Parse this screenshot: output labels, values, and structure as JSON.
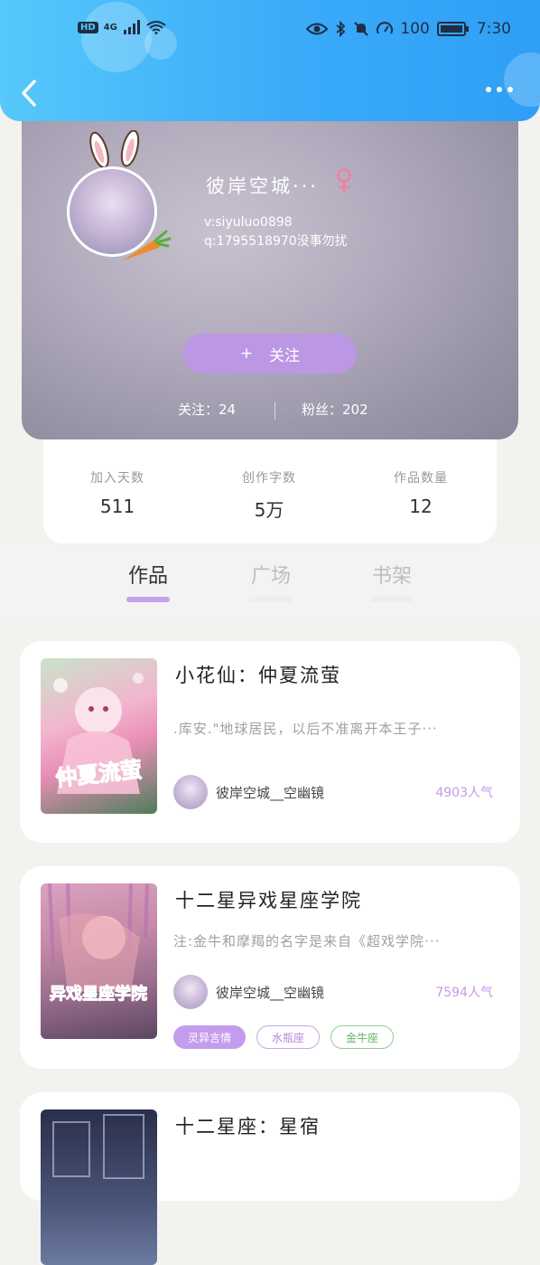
{
  "status_bar": {
    "hd": "HD",
    "network": "4G",
    "battery": "100",
    "time": "7:30"
  },
  "profile": {
    "nickname": "彼岸空城···",
    "bio_line1": "v:siyuluo0898",
    "bio_line2": "q:1795518970没事勿扰",
    "follow_plus": "+",
    "follow_label": "关注",
    "following": "关注：24",
    "fans": "粉丝：202"
  },
  "stats": [
    {
      "label": "加入天数",
      "value": "511"
    },
    {
      "label": "创作字数",
      "value": "5万"
    },
    {
      "label": "作品数量",
      "value": "12"
    }
  ],
  "tabs": [
    {
      "label": "作品",
      "active": true
    },
    {
      "label": "广场",
      "active": false
    },
    {
      "label": "书架",
      "active": false
    }
  ],
  "books": [
    {
      "title": "小花仙：仲夏流萤",
      "desc": ".库安.\"地球居民，以后不准离开本王子···",
      "author": "彼岸空城__空幽镜",
      "popularity": "4903人气",
      "cover_text": "仲夏流萤"
    },
    {
      "title": "十二星异戏星座学院",
      "desc": "注:金牛和摩羯的名字是来自《超戏学院···",
      "author": "彼岸空城__空幽镜",
      "popularity": "7594人气",
      "cover_text": "异戏星座学院",
      "tags": [
        "灵异言情",
        "水瓶座",
        "金牛座"
      ]
    },
    {
      "title": "十二星座：星宿"
    }
  ],
  "colors": {
    "header_gradient_start": "#56c8fa",
    "header_gradient_end": "#2f9ff6",
    "accent_purple": "#bb97e4",
    "female_pink": "#f27fa0",
    "popularity_purple": "#c59ae6"
  }
}
